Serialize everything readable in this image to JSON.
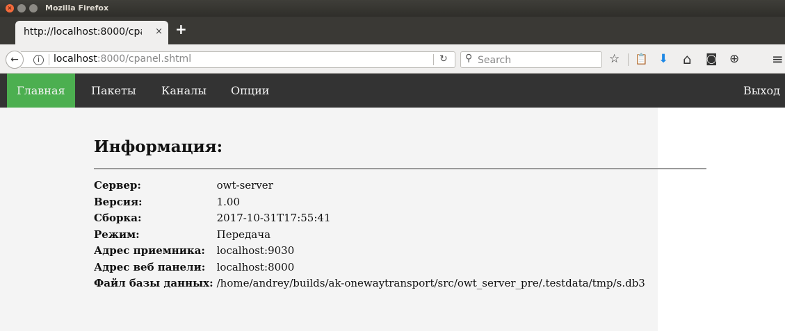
{
  "window": {
    "title": "Mozilla Firefox",
    "close_glyph": "×"
  },
  "tab": {
    "label": "http://localhost:8000/cpa",
    "close": "×",
    "new_tab": "+"
  },
  "navbar": {
    "back_icon": "←",
    "info_icon": "i",
    "url_host": "localhost",
    "url_rest": ":8000/cpanel.shtml",
    "reload_icon": "↻",
    "search_placeholder": "Search",
    "search_icon": "⚲",
    "icons": {
      "bookmark_star": "☆",
      "reading_list": "📋",
      "downloads": "⬇",
      "home": "⌂",
      "pocket": "◙",
      "globe": "⊕",
      "menu": "≡"
    }
  },
  "site_nav": {
    "items": [
      {
        "label": "Главная",
        "active": true
      },
      {
        "label": "Пакеты",
        "active": false
      },
      {
        "label": "Каналы",
        "active": false
      },
      {
        "label": "Опции",
        "active": false
      }
    ],
    "logout": "Выход",
    "active_color": "#4caf50",
    "bar_color": "#333333"
  },
  "info": {
    "title": "Информация:",
    "rows": [
      {
        "key": "Сервер:",
        "value": "owt-server"
      },
      {
        "key": "Версия:",
        "value": "1.00"
      },
      {
        "key": "Сборка:",
        "value": "2017-10-31T17:55:41"
      },
      {
        "key": "Режим:",
        "value": "Передача"
      },
      {
        "key": "Адрес приемника:",
        "value": "localhost:9030"
      },
      {
        "key": "Адрес веб панели:",
        "value": "localhost:8000"
      },
      {
        "key": "Файл базы данных:",
        "value": "/home/andrey/builds/ak-onewaytransport/src/owt_server_pre/.testdata/tmp/s.db3"
      }
    ]
  }
}
